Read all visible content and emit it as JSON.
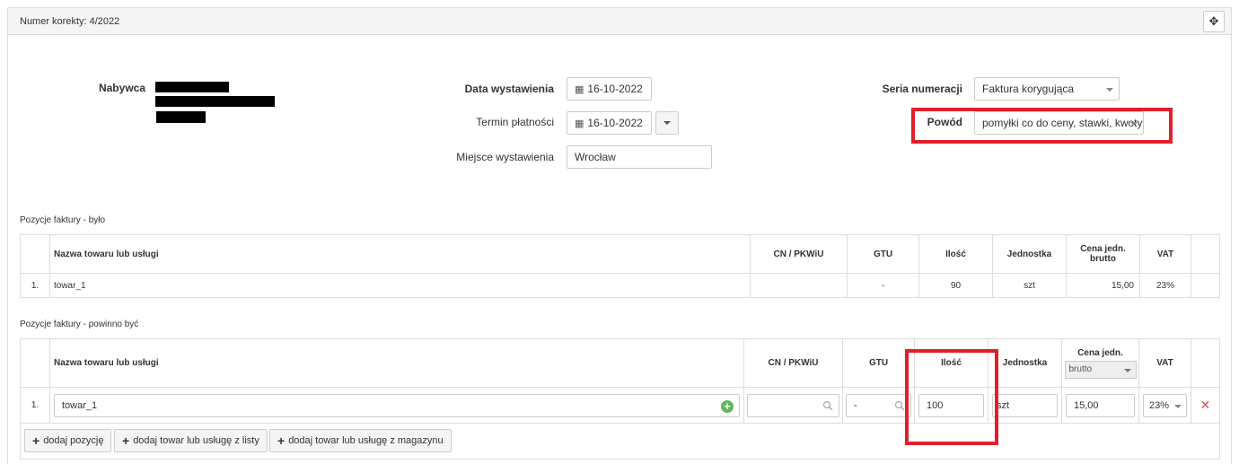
{
  "panel": {
    "title": "Numer korekty: 4/2022"
  },
  "buyer": {
    "label": "Nabywca"
  },
  "dates": {
    "issue_label": "Data wystawienia",
    "issue_value": "16-10-2022",
    "due_label": "Termin płatności",
    "due_value": "16-10-2022",
    "place_label": "Miejsce wystawienia",
    "place_value": "Wrocław"
  },
  "numbering": {
    "series_label": "Seria numeracji",
    "series_value": "Faktura korygująca",
    "reason_label": "Powód",
    "reason_value": "pomyłki co do ceny, stawki, kwoty"
  },
  "was": {
    "title": "Pozycje faktury - było",
    "headers": [
      "Nazwa towaru lub usługi",
      "CN / PKWiU",
      "GTU",
      "Ilość",
      "Jednostka",
      "Cena jedn. brutto",
      "VAT"
    ],
    "rows": [
      {
        "no": "1.",
        "name": "towar_1",
        "cn": "",
        "gtu": "-",
        "qty": "90",
        "unit": "szt",
        "price": "15,00",
        "vat": "23%"
      }
    ]
  },
  "should": {
    "title": "Pozycje faktury - powinno być",
    "headers": [
      "Nazwa towaru lub usługi",
      "CN / PKWiU",
      "GTU",
      "Ilość",
      "Jednostka",
      "Cena jedn.",
      "VAT"
    ],
    "price_type": "brutto",
    "rows": [
      {
        "no": "1.",
        "name": "towar_1",
        "cn": "",
        "gtu": "-",
        "qty": "100",
        "unit": "szt",
        "price": "15,00",
        "vat": "23%"
      }
    ]
  },
  "buttons": {
    "add_position": "dodaj pozycję",
    "add_from_list": "dodaj towar lub usługę z listy",
    "add_from_warehouse": "dodaj towar lub usługę z magazynu"
  },
  "colors": {
    "highlight": "#e0202a",
    "add_icon": "#5cb85c",
    "remove_icon": "#d9534f"
  }
}
